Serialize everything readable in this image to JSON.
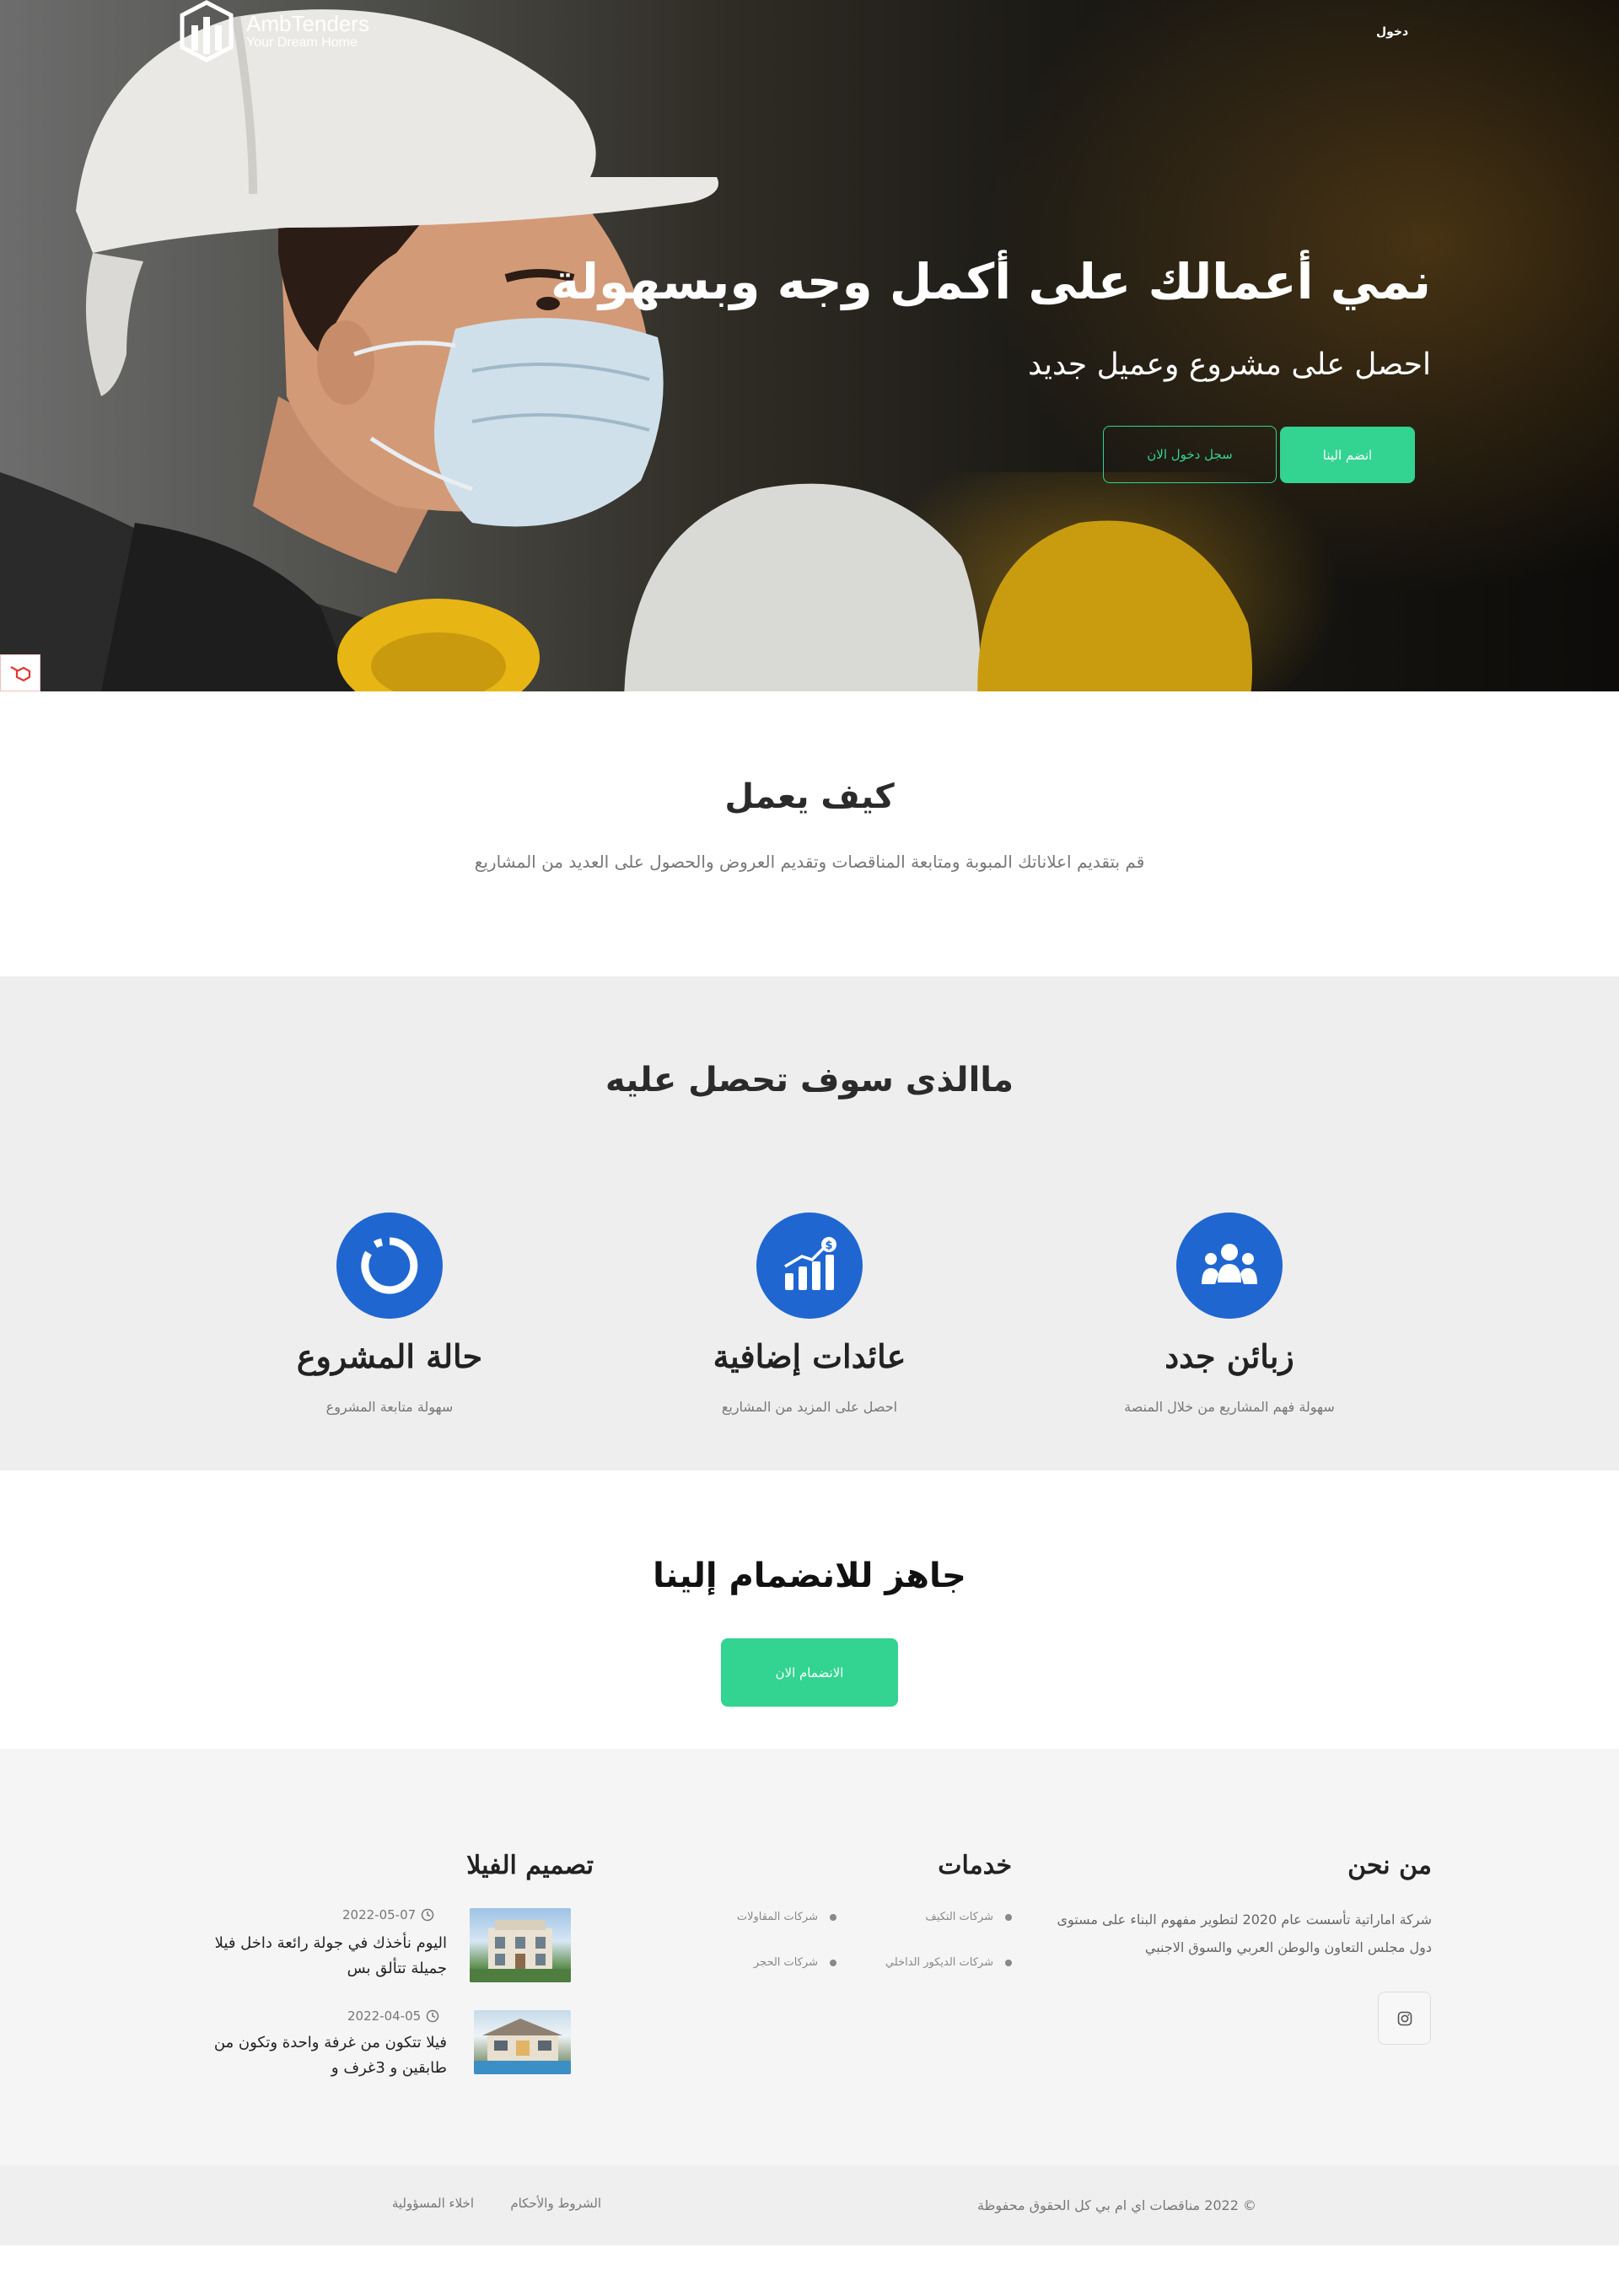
{
  "brand": {
    "name": "AmbTenders",
    "tagline": "Your Dream Home"
  },
  "nav": {
    "login": "دخول"
  },
  "hero": {
    "title": "نمي أعمالك على أكمل وجه وبسهولة",
    "subtitle": "احصل على مشروع وعميل جديد",
    "join_button": "انضم الينا",
    "login_button": "سجل دخول الان"
  },
  "how": {
    "title": "كيف يعمل",
    "description": "قم بتقديم اعلاناتك المبوبة ومتابعة المناقصات وتقديم العروض والحصول على العديد من المشاريع"
  },
  "benefits": {
    "title": "ماالذى سوف تحصل عليه",
    "items": [
      {
        "icon": "users-icon",
        "title": "زبائن جدد",
        "desc": "سهولة فهم المشاريع من خلال المنصة"
      },
      {
        "icon": "chart-dollar-icon",
        "title": "عائدات إضافية",
        "desc": "احصل على المزيد من المشاريع"
      },
      {
        "icon": "progress-circle-icon",
        "title": "حالة المشروع",
        "desc": "سهولة متابعة المشروع"
      }
    ]
  },
  "cta": {
    "title": "جاهز للانضمام إلينا",
    "button": "الانضمام الان"
  },
  "footer": {
    "about_title": "من نحن",
    "about_text": "شركة اماراتية تأسست عام 2020 لتطوير مفهوم البناء على مستوى دول مجلس التعاون والوطن العربي والسوق الاجنبي",
    "services_title": "خدمات",
    "services": [
      "شركات التكيف",
      "شركات المقاولات",
      "شركات الديكور الداخلي",
      "شركات الحجر"
    ],
    "villa_title": "تصميم الفيلا",
    "posts": [
      {
        "date": "2022-05-07",
        "text": "اليوم نأخذك في جولة رائعة داخل فيلا جميلة تتألق بس"
      },
      {
        "date": "2022-04-05",
        "text": "فيلا تتكون من غرفة واحدة وتكون من طابقين و 3غرف و"
      }
    ]
  },
  "bottom": {
    "copyright": "© 2022 مناقصات اي ام بي كل الحقوق محفوظة",
    "terms": "الشروط والأحكام",
    "disclaimer": "اخلاء المسؤولية"
  },
  "colors": {
    "accent": "#33d391",
    "icon_bg": "#1f66d1"
  }
}
